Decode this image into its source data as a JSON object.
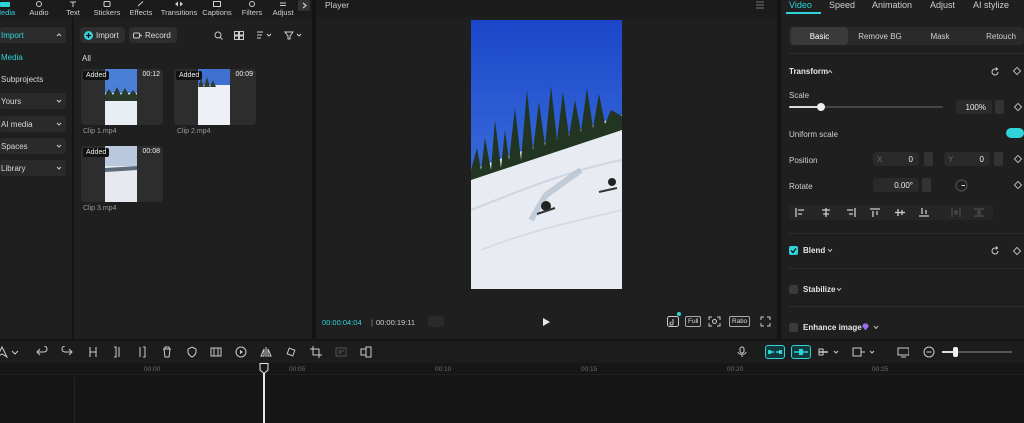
{
  "toolbar": {
    "items": [
      {
        "label": "Media",
        "icon": "media-icon"
      },
      {
        "label": "Audio",
        "icon": "audio-icon"
      },
      {
        "label": "Text",
        "icon": "text-icon"
      },
      {
        "label": "Stickers",
        "icon": "stickers-icon"
      },
      {
        "label": "Effects",
        "icon": "effects-icon"
      },
      {
        "label": "Transitions",
        "icon": "transitions-icon"
      },
      {
        "label": "Captions",
        "icon": "captions-icon"
      },
      {
        "label": "Filters",
        "icon": "filters-icon"
      },
      {
        "label": "Adjust",
        "icon": "adjust-icon"
      }
    ]
  },
  "sidebar": {
    "items": [
      {
        "label": "Import"
      },
      {
        "label": "Media"
      },
      {
        "label": "Subprojects"
      },
      {
        "label": "Yours"
      },
      {
        "label": "AI media"
      },
      {
        "label": "Spaces"
      },
      {
        "label": "Library"
      }
    ]
  },
  "media": {
    "import_label": "Import",
    "record_label": "Record",
    "filter_all": "All",
    "clips": [
      {
        "name": "Clip 1.mp4",
        "badge": "Added",
        "duration": "00:12"
      },
      {
        "name": "Clip 2.mp4",
        "badge": "Added",
        "duration": "00:09"
      },
      {
        "name": "Clip 3.mp4",
        "badge": "Added",
        "duration": "00:08"
      }
    ]
  },
  "player": {
    "title": "Player",
    "current_time": "00:00:04:04",
    "total_time": "00:00:19:11",
    "full_label": "Full",
    "ratio_label": "Ratio"
  },
  "right_panel": {
    "tabs": [
      "Video",
      "Speed",
      "Animation",
      "Adjust",
      "AI stylize"
    ],
    "subtabs": [
      "Basic",
      "Remove BG",
      "Mask",
      "Retouch"
    ],
    "transform_label": "Transform",
    "scale_label": "Scale",
    "scale_value": "100%",
    "scale_fraction": 0.21,
    "uniform_scale_label": "Uniform scale",
    "position_label": "Position",
    "x_label": "X",
    "x_value": "0",
    "y_label": "Y",
    "y_value": "0",
    "rotate_label": "Rotate",
    "rotate_value": "0.00°",
    "blend_label": "Blend",
    "stabilize_label": "Stabilize",
    "enhance_label": "Enhance image"
  },
  "timeline": {
    "ticks": [
      "00:00",
      "00:05",
      "00:10",
      "00:15",
      "00:20",
      "00:25"
    ]
  },
  "colors": {
    "accent": "#2fd3d9",
    "panel": "#1f1f1f"
  }
}
